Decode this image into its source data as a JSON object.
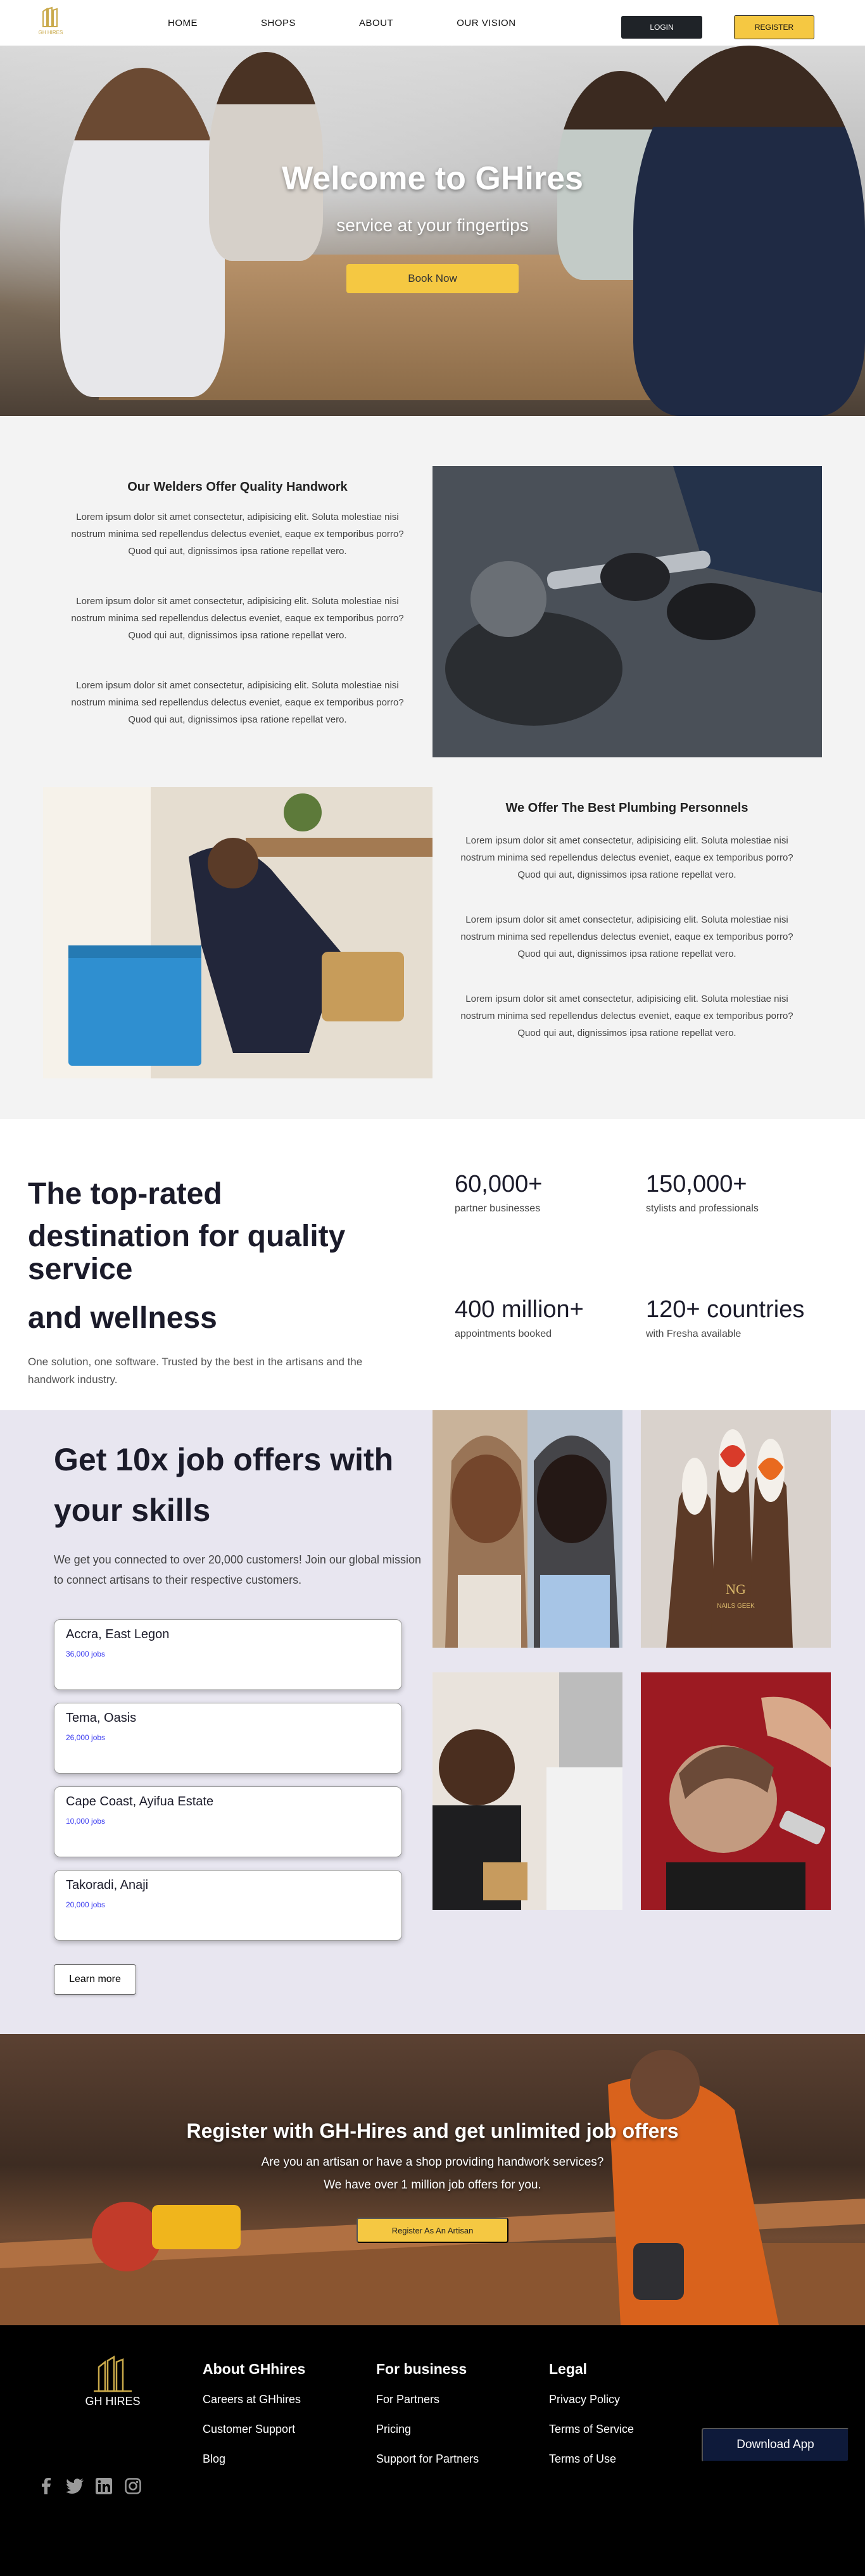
{
  "nav": {
    "logo_text": "GH HIRES",
    "links": [
      "HOME",
      "SHOPS",
      "ABOUT",
      "OUR VISION"
    ],
    "login": "LOGIN",
    "register": "REGISTER"
  },
  "hero": {
    "title": "Welcome to GHires",
    "subtitle": "service at your fingertips",
    "button": "Book Now"
  },
  "welders": {
    "title": "Our Welders Offer Quality Handwork",
    "paragraphs": [
      "Lorem ipsum dolor sit amet consectetur, adipisicing elit. Soluta molestiae nisi nostrum minima sed repellendus delectus eveniet, eaque ex temporibus porro? Quod qui aut, dignissimos ipsa ratione repellat vero.",
      "Lorem ipsum dolor sit amet consectetur, adipisicing elit. Soluta molestiae nisi nostrum minima sed repellendus delectus eveniet, eaque ex temporibus porro? Quod qui aut, dignissimos ipsa ratione repellat vero.",
      "Lorem ipsum dolor sit amet consectetur, adipisicing elit. Soluta molestiae nisi nostrum minima sed repellendus delectus eveniet, eaque ex temporibus porro? Quod qui aut, dignissimos ipsa ratione repellat vero."
    ]
  },
  "plumbing": {
    "title": "We Offer The Best Plumbing Personnels",
    "paragraphs": [
      "Lorem ipsum dolor sit amet consectetur, adipisicing elit. Soluta molestiae nisi nostrum minima sed repellendus delectus eveniet, eaque ex temporibus porro? Quod qui aut, dignissimos ipsa ratione repellat vero.",
      "Lorem ipsum dolor sit amet consectetur, adipisicing elit. Soluta molestiae nisi nostrum minima sed repellendus delectus eveniet, eaque ex temporibus porro? Quod qui aut, dignissimos ipsa ratione repellat vero.",
      "Lorem ipsum dolor sit amet consectetur, adipisicing elit. Soluta molestiae nisi nostrum minima sed repellendus delectus eveniet, eaque ex temporibus porro? Quod qui aut, dignissimos ipsa ratione repellat vero."
    ]
  },
  "stats": {
    "heading_lines": [
      "The top-rated",
      "destination for quality service",
      "and wellness"
    ],
    "description": "One solution, one software. Trusted by the best in the artisans and the handwork industry.",
    "items": [
      {
        "value": "60,000+",
        "label": "partner businesses"
      },
      {
        "value": "150,000+",
        "label": "stylists and professionals"
      },
      {
        "value": "400 million+",
        "label": "appointments booked"
      },
      {
        "value": "120+ countries",
        "label": "with Fresha available"
      }
    ]
  },
  "jobs": {
    "title": "Get 10x job offers with your skills",
    "description": "We get you connected to over 20,000 customers! Join our global mission to connect artisans to their respective customers.",
    "locations": [
      {
        "name": "Accra, East Legon",
        "count": "36,000 jobs"
      },
      {
        "name": "Tema, Oasis",
        "count": "26,000 jobs"
      },
      {
        "name": "Cape Coast, Ayifua Estate",
        "count": "10,000 jobs"
      },
      {
        "name": "Takoradi, Anaji",
        "count": "20,000 jobs"
      }
    ],
    "learn_more": "Learn more",
    "nail_brand": "NAILS GEEK"
  },
  "banner": {
    "title": "Register with GH-Hires and get unlimited job offers",
    "line1": "Are you an artisan or have a shop providing handwork services?",
    "line2": "We have over 1 million job offers for you.",
    "button": "Register As An Artisan"
  },
  "footer": {
    "logo_text": "GH HIRES",
    "about": {
      "title": "About GHhires",
      "items": [
        "Careers at GHhires",
        "Customer Support",
        "Blog"
      ]
    },
    "business": {
      "title": "For business",
      "items": [
        "For Partners",
        "Pricing",
        "Support for Partners"
      ]
    },
    "legal": {
      "title": "Legal",
      "items": [
        "Privacy Policy",
        "Terms of Service",
        "Terms of Use"
      ]
    },
    "download": "Download App",
    "socials": [
      "facebook-icon",
      "twitter-icon",
      "linkedin-icon",
      "instagram-icon"
    ]
  },
  "colors": {
    "accent": "#f5c842",
    "dark": "#1f2328",
    "footer_bg": "#000000",
    "jobs_bg": "#e8e6f0",
    "link_blue": "#3a3af0"
  }
}
